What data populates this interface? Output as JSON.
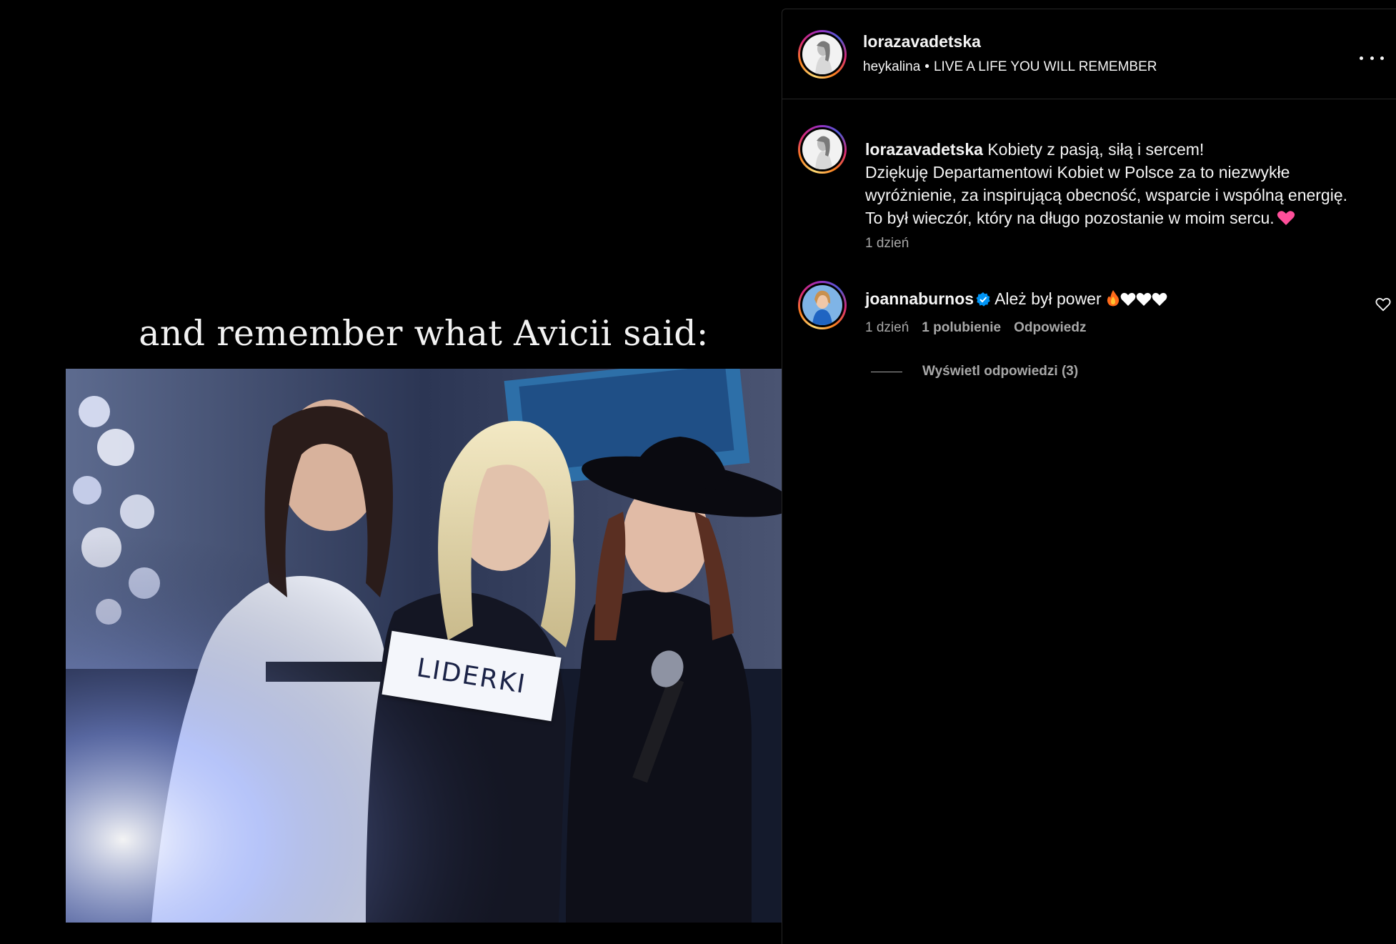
{
  "media": {
    "overlay_text": "and remember what Avicii said:",
    "sign_text": "LIDERKI"
  },
  "header": {
    "username": "lorazavadetska",
    "audio_artist": "heykalina",
    "audio_separator": "•",
    "audio_title": "LIVE A LIFE YOU WILL REMEMBER",
    "more_icon": "more-horizontal-icon"
  },
  "caption": {
    "username": "lorazavadetska",
    "line1": "Kobiety z pasją, siłą i sercem!",
    "line2": "Dziękuję Departamentowi Kobiet w Polsce za to niezwykłe wyróżnienie, za inspirującą obecność, wsparcie i wspólną energię.",
    "line3": "To był wieczór, który na długo pozostanie w moim sercu.",
    "emoji": "pink-heart-icon",
    "time": "1 dzień"
  },
  "comment": {
    "username": "joannaburnos",
    "verified_icon": "verified-badge-icon",
    "text": "Ależ był power",
    "emojis": [
      "fire-icon",
      "white-heart-icon",
      "white-heart-icon",
      "white-heart-icon"
    ],
    "time": "1 dzień",
    "likes": "1 polubienie",
    "reply": "Odpowiedz",
    "like_icon": "heart-outline-icon"
  },
  "replies": {
    "label": "Wyświetl odpowiedzi (3)"
  },
  "colors": {
    "background": "#000000",
    "text_primary": "#f5f5f5",
    "text_secondary": "#a8a8a8",
    "verified_blue": "#0095f6",
    "divider": "#262626"
  }
}
